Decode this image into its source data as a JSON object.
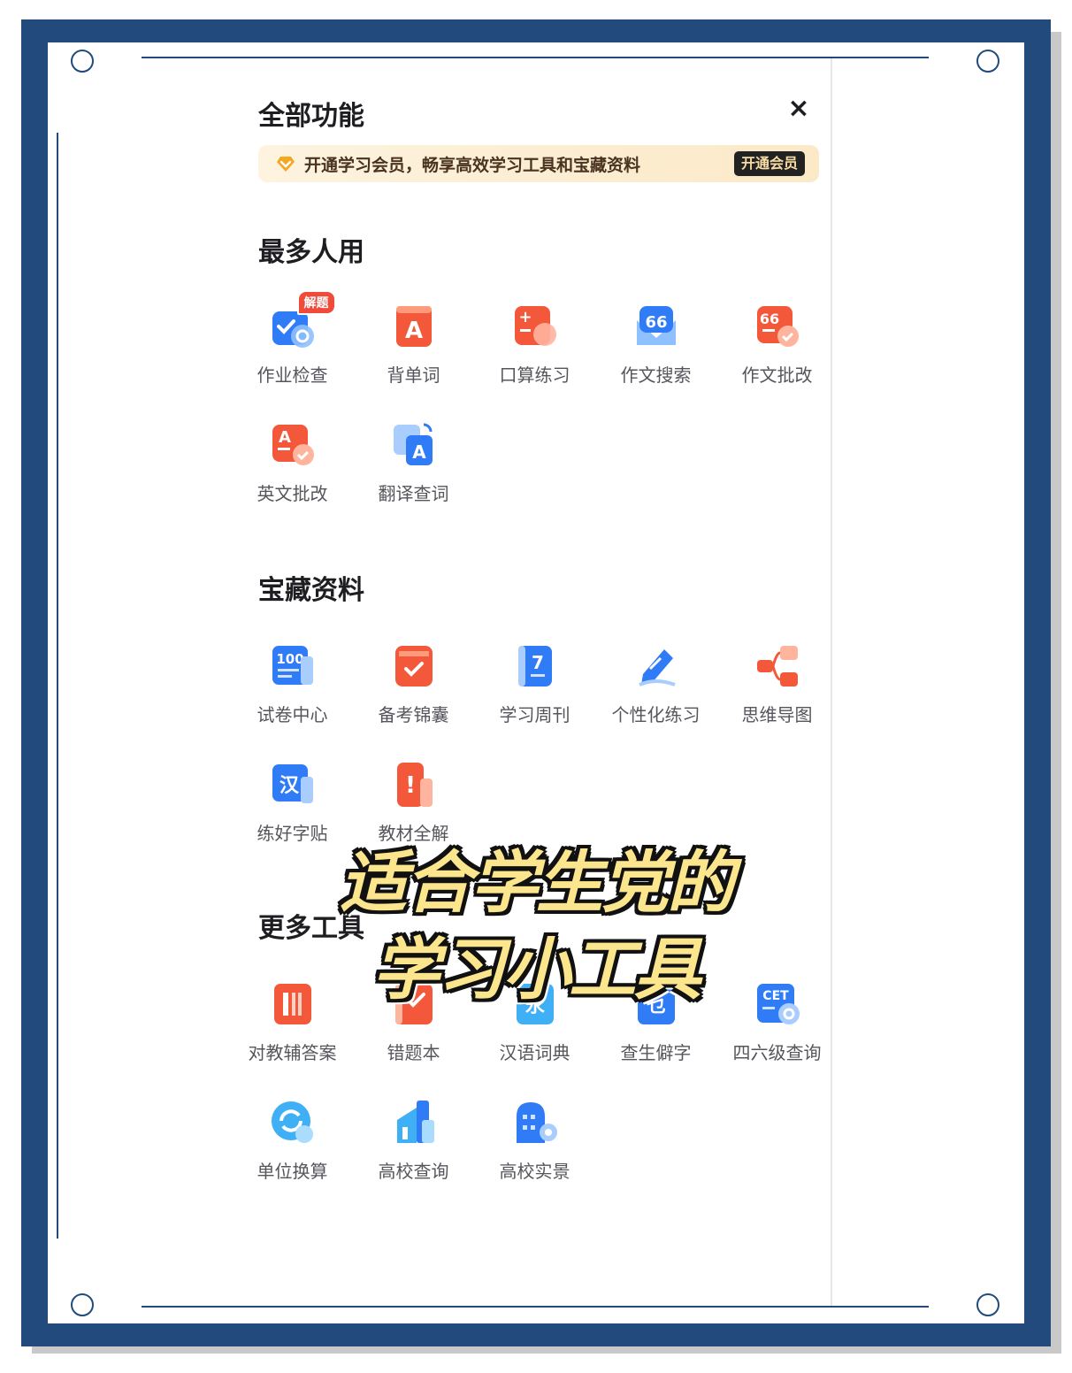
{
  "panel": {
    "title": "全部功能",
    "close_symbol": "×",
    "banner_text": "开通学习会员，畅享高效学习工具和宝藏资料",
    "banner_button": "开通会员"
  },
  "sections": [
    {
      "title": "最多人用",
      "tools": [
        {
          "label": "作业检查",
          "icon": "homework-check-icon",
          "badge": "解题"
        },
        {
          "label": "背单词",
          "icon": "vocabulary-icon"
        },
        {
          "label": "口算练习",
          "icon": "mental-math-icon"
        },
        {
          "label": "作文搜索",
          "icon": "essay-search-icon"
        },
        {
          "label": "作文批改",
          "icon": "essay-grading-icon"
        },
        {
          "label": "英文批改",
          "icon": "english-grading-icon"
        },
        {
          "label": "翻译查词",
          "icon": "translate-icon"
        }
      ]
    },
    {
      "title": "宝藏资料",
      "tools": [
        {
          "label": "试卷中心",
          "icon": "exam-center-icon"
        },
        {
          "label": "备考锦囊",
          "icon": "exam-prep-icon"
        },
        {
          "label": "学习周刊",
          "icon": "study-weekly-icon"
        },
        {
          "label": "个性化练习",
          "icon": "personal-practice-icon"
        },
        {
          "label": "思维导图",
          "icon": "mind-map-icon"
        },
        {
          "label": "练好字贴",
          "icon": "calligraphy-icon"
        },
        {
          "label": "教材全解",
          "icon": "textbook-icon"
        }
      ]
    },
    {
      "title": "更多工具",
      "tools": [
        {
          "label": "对教辅答案",
          "icon": "answer-check-icon"
        },
        {
          "label": "错题本",
          "icon": "mistake-book-icon"
        },
        {
          "label": "汉语词典",
          "icon": "chinese-dictionary-icon"
        },
        {
          "label": "查生僻字",
          "icon": "rare-character-icon"
        },
        {
          "label": "四六级查询",
          "icon": "cet-query-icon"
        },
        {
          "label": "单位换算",
          "icon": "unit-convert-icon"
        },
        {
          "label": "高校查询",
          "icon": "college-query-icon"
        },
        {
          "label": "高校实景",
          "icon": "campus-view-icon"
        }
      ]
    }
  ],
  "icon_glyphs": {
    "vocabulary": "A",
    "mental_math": "+",
    "essay_quote": "66",
    "english": "A",
    "translate": "A",
    "exam": "100",
    "weekly": "7",
    "calligraphy": "汉",
    "textbook": "!",
    "dictionary": "永",
    "rare": "乜",
    "cet": "CET"
  },
  "overlay": {
    "line1": "适合学生党的",
    "line2": "学习小工具"
  },
  "colors": {
    "frame": "#234a7c",
    "blue": "#2f7cf6",
    "orange": "#f4583a",
    "banner_bg": "#fdf0d6",
    "caption": "#fbe58d"
  }
}
